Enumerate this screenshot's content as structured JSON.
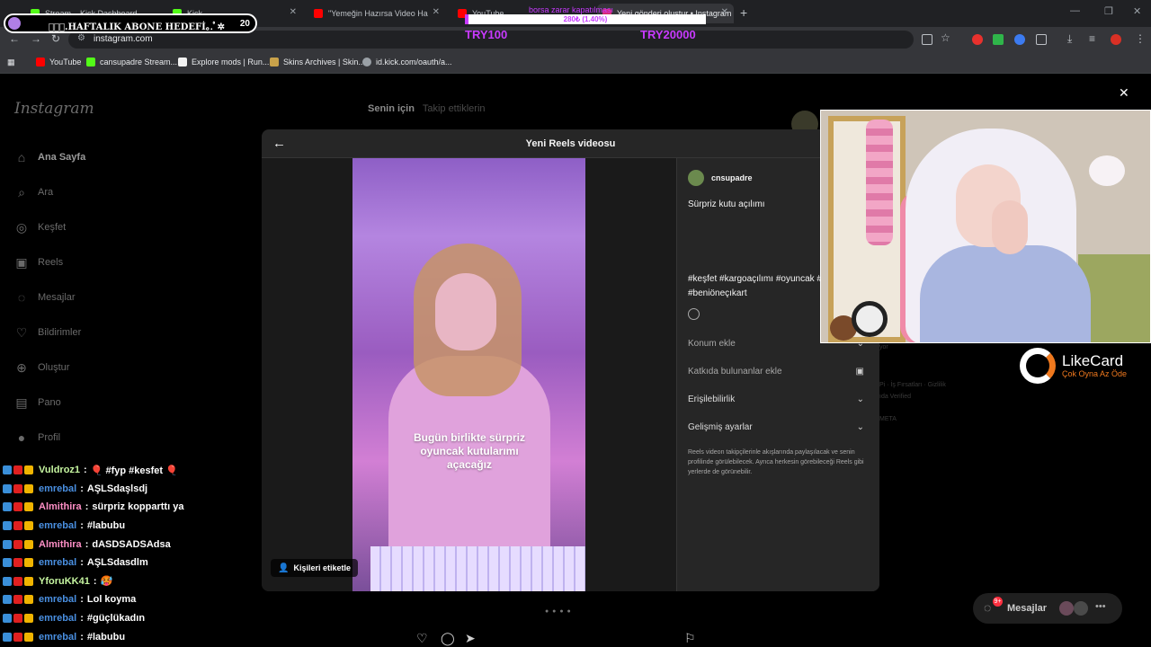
{
  "browser": {
    "tabs": [
      {
        "title": "Stream – Kick Dashboard",
        "fav_color": "#53fc18"
      },
      {
        "title": "Kick",
        "fav_color": "#53fc18"
      },
      {
        "title": "\"Yemeğin Hazırsa Video Ha",
        "fav_color": "#ff0000"
      },
      {
        "title": "YouTube",
        "fav_color": "#ff0000"
      },
      {
        "title": "Yeni gönderi oluştur • Instagram",
        "fav_color": "#d62976"
      }
    ],
    "url": "instagram.com",
    "bookmarks": [
      {
        "label": "YouTube",
        "fav_color": "#ff0000"
      },
      {
        "label": "cansupadre Stream...",
        "fav_color": "#53fc18"
      },
      {
        "label": "Explore mods | Run...",
        "fav_color": "#f2f2f2"
      },
      {
        "label": "Skins Archives | Skin...",
        "fav_color": "#c9a24a"
      },
      {
        "label": "id.kick.com/oauth/a...",
        "fav_color": "#9aa0a6"
      }
    ]
  },
  "overlay": {
    "goal_text": "✲ﾟ｡.HAFTALIK ABONE HEDEFİ｡.ﾟ✲",
    "goal_count": "20",
    "borsa_title": "borsa zarar kapatılması",
    "borsa_progress_label": "280₺ (1.40%)",
    "borsa_progress_percent": 1.4,
    "borsa_start": "TRY100",
    "borsa_target": "TRY20000",
    "accent_color": "#c83aff"
  },
  "instagram": {
    "logo": "Instagram",
    "nav": [
      {
        "label": "Ana Sayfa",
        "icon": "home-icon"
      },
      {
        "label": "Ara",
        "icon": "search-icon"
      },
      {
        "label": "Keşfet",
        "icon": "compass-icon"
      },
      {
        "label": "Reels",
        "icon": "reels-icon"
      },
      {
        "label": "Mesajlar",
        "icon": "messenger-icon"
      },
      {
        "label": "Bildirimler",
        "icon": "heart-icon"
      },
      {
        "label": "Oluştur",
        "icon": "plus-square-icon"
      },
      {
        "label": "Pano",
        "icon": "dashboard-icon"
      },
      {
        "label": "Profil",
        "icon": "avatar-icon"
      }
    ],
    "feed_tab_active": "Senin için",
    "feed_tab_other": "Takip ettiklerin",
    "messages_pill_label": "Mesajlar"
  },
  "modal": {
    "title": "Yeni Reels videosu",
    "username": "cnsupadre",
    "caption": "Sürpriz kutu açılımı",
    "hashtags": "#keşfet #kargoaçılımı #oyuncak #keşfetteyiz #beniöneçıkart",
    "video_caption": "Bugün birlikte sürpriz oyuncak kutularımı açacağız",
    "tag_people": "Kişileri etiketle",
    "options": [
      {
        "label": "Konum ekle",
        "style": "muted",
        "icon": "chevron"
      },
      {
        "label": "Katkıda bulunanlar ekle",
        "style": "muted",
        "icon": "person-tag"
      },
      {
        "label": "Erişilebilirlik",
        "style": "normal",
        "icon": "chevron"
      },
      {
        "label": "Gelişmiş ayarlar",
        "style": "normal",
        "icon": "chevron"
      }
    ],
    "notice": "Reels videon takipçilerinle akışlarında paylaşılacak ve senin profilinde görülebilecek. Ayrıca herkesin görebileceği Reels gibi yerlerde de görünebilir."
  },
  "sponsor": {
    "name": "LikeCard",
    "tagline": "Çok Oyna  Az Öde",
    "accent": "#f0791e"
  },
  "chat": [
    {
      "user": "Vuldroz1",
      "user_color": "#c6f5a0",
      "message": "🎈 #fyp #kesfet 🎈"
    },
    {
      "user": "emrebal",
      "user_color": "#4a90e2",
      "message": "AŞLSdaşlsdj"
    },
    {
      "user": "Almithira",
      "user_color": "#ff8fc6",
      "message": "sürpriz kopparttı ya"
    },
    {
      "user": "emrebal",
      "user_color": "#4a90e2",
      "message": "#labubu"
    },
    {
      "user": "Almithira",
      "user_color": "#ff8fc6",
      "message": "dASDSADSAdsa"
    },
    {
      "user": "emrebal",
      "user_color": "#4a90e2",
      "message": "AŞLSdasdlm"
    },
    {
      "user": "YforuKK41",
      "user_color": "#c6f5a0",
      "message": "🥵"
    },
    {
      "user": "emrebal",
      "user_color": "#4a90e2",
      "message": "Lol koyma"
    },
    {
      "user": "emrebal",
      "user_color": "#4a90e2",
      "message": "#güçlükadın"
    },
    {
      "user": "emrebal",
      "user_color": "#4a90e2",
      "message": "#labubu"
    }
  ]
}
